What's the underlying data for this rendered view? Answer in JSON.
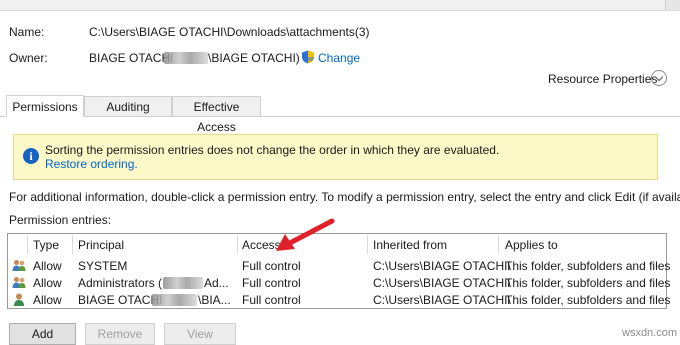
{
  "header": {
    "name_label": "Name:",
    "name_value": "C:\\Users\\BIAGE OTACHI\\Downloads\\attachments(3)",
    "owner_label": "Owner:",
    "owner_prefix": "BIAGE OTACHI",
    "owner_suffix": "\\BIAGE OTACHI)",
    "change_link": "Change",
    "resource_properties": "Resource Properties"
  },
  "tabs": [
    {
      "label": "Permissions",
      "active": true
    },
    {
      "label": "Auditing",
      "active": false
    },
    {
      "label": "Effective Access",
      "active": false
    }
  ],
  "info": {
    "message": "Sorting the permission entries does not change the order in which they are evaluated.",
    "restore_link": "Restore ordering."
  },
  "instructions": "For additional information, double-click a permission entry. To modify a permission entry, select the entry and click Edit (if available).",
  "entries_label": "Permission entries:",
  "table": {
    "columns": [
      "Type",
      "Principal",
      "Access",
      "Inherited from",
      "Applies to"
    ],
    "rows": [
      {
        "type": "Allow",
        "principal": "SYSTEM",
        "access": "Full control",
        "inherited": "C:\\Users\\BIAGE OTACHI\\",
        "applies": "This folder, subfolders and files"
      },
      {
        "type": "Allow",
        "principal_start": "Administrators (",
        "principal_end": "Ad...",
        "access": "Full control",
        "inherited": "C:\\Users\\BIAGE OTACHI\\",
        "applies": "This folder, subfolders and files"
      },
      {
        "type": "Allow",
        "principal_start": "BIAGE OTACHI",
        "principal_end": "\\BIA...",
        "access": "Full control",
        "inherited": "C:\\Users\\BIAGE OTACHI\\",
        "applies": "This folder, subfolders and files"
      }
    ]
  },
  "buttons": {
    "add": "Add",
    "remove": "Remove",
    "view": "View"
  },
  "watermark": "wsxdn.com",
  "colors": {
    "link": "#0066cc",
    "infobar": "#fdf8c7",
    "arrow": "#e0202a"
  }
}
